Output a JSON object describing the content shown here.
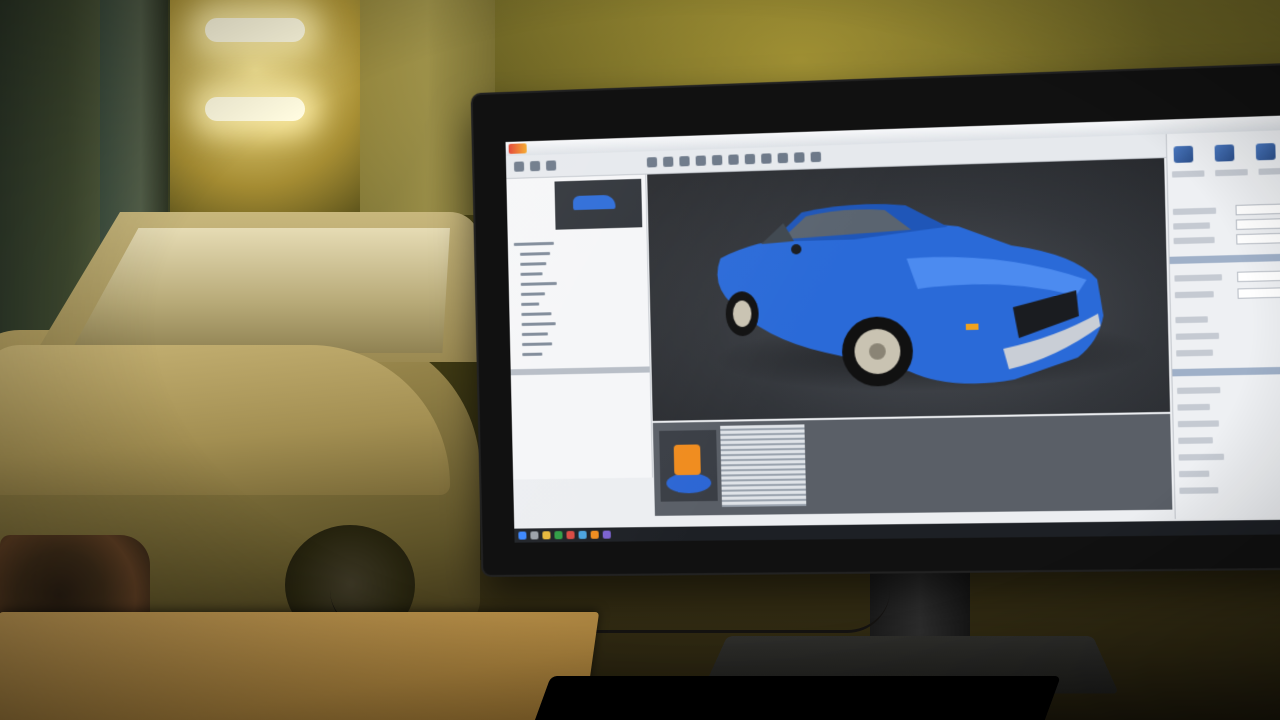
{
  "scene": {
    "description_tags": [
      "garage-background",
      "dusty-muscle-car",
      "computer-monitor",
      "3d-car-model"
    ],
    "colors": {
      "garage_light": "#fffbe0",
      "dusty_car": "#a38f52",
      "model_car_blue": "#2a6ad8",
      "monitor_bezel": "#111111",
      "app_background": "#eceef1",
      "viewport_background": "#33363b",
      "taskbar": "#1d2025"
    }
  },
  "app": {
    "panels": [
      "toolbar",
      "scene-tree",
      "3d-viewport",
      "properties-panel",
      "taskbar"
    ],
    "viewport_model": "blue muscle car"
  }
}
